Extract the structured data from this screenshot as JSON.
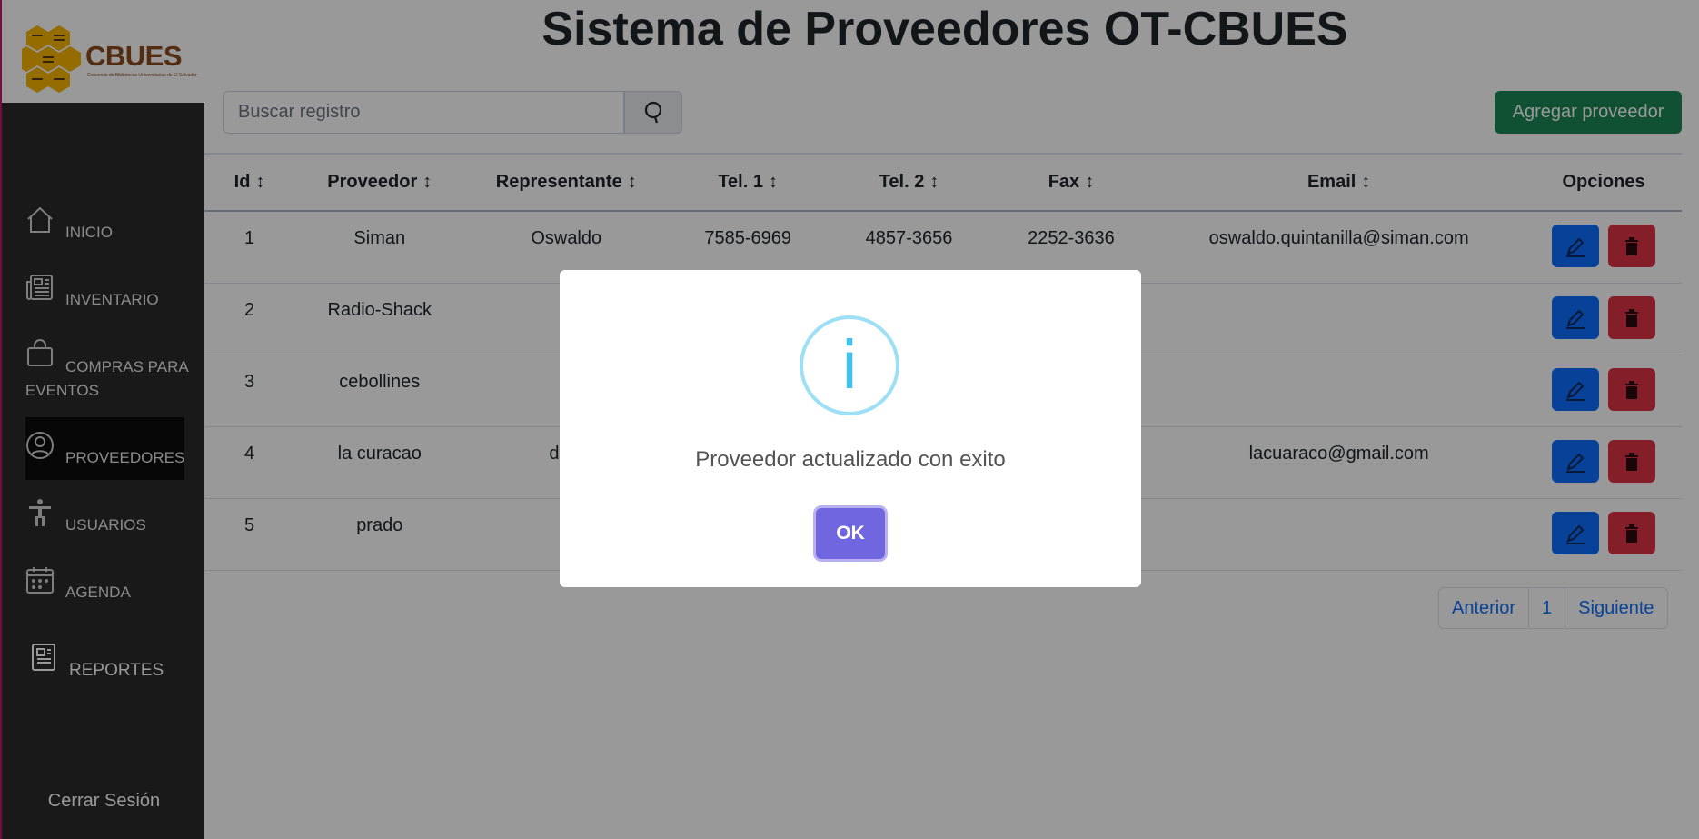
{
  "brand": {
    "name": "CBUES",
    "subtitle": "Consorcio de Bibliotecas Universitarias de El Salvador",
    "colors": {
      "brand_brown": "#8c4a1c",
      "honey": "#f7b500"
    }
  },
  "sidebar": {
    "items": [
      {
        "label": "INICIO",
        "icon": "home-icon"
      },
      {
        "label": "INVENTARIO",
        "icon": "newspaper-icon"
      },
      {
        "label_line1": "COMPRAS PARA",
        "label_line2": "EVENTOS",
        "icon": "shopping-bag-icon"
      },
      {
        "label": "PROVEEDORES",
        "icon": "person-circle-icon",
        "active": true
      },
      {
        "label": "USUARIOS",
        "icon": "universal-access-icon"
      },
      {
        "label": "AGENDA",
        "icon": "calendar-icon"
      },
      {
        "label": "REPORTES",
        "icon": "report-icon"
      }
    ],
    "logout_label": "Cerrar Sesión"
  },
  "main": {
    "title": "Sistema de Proveedores OT-CBUES",
    "search_placeholder": "Buscar registro",
    "add_button": "Agregar proveedor",
    "table": {
      "headers": [
        "Id",
        "Proveedor",
        "Representante",
        "Tel. 1",
        "Tel. 2",
        "Fax",
        "Email",
        "Opciones"
      ],
      "rows": [
        {
          "id": "1",
          "proveedor": "Siman",
          "representante": "Oswaldo",
          "tel1": "7585-6969",
          "tel2": "4857-3656",
          "fax": "2252-3636",
          "email": "oswaldo.quintanilla@siman.com"
        },
        {
          "id": "2",
          "proveedor": "Radio-Shack",
          "representante": "",
          "tel1": "",
          "tel2": "",
          "fax": "",
          "email": ""
        },
        {
          "id": "3",
          "proveedor": "cebollines",
          "representante": "",
          "tel1": "",
          "tel2": "",
          "fax": "",
          "email": ""
        },
        {
          "id": "4",
          "proveedor": "la curacao",
          "representante": "dani",
          "tel1": "",
          "tel2": "",
          "fax": "",
          "email": "lacuaraco@gmail.com"
        },
        {
          "id": "5",
          "proveedor": "prado",
          "representante": "",
          "tel1": "",
          "tel2": "",
          "fax": "",
          "email": ""
        }
      ]
    },
    "pagination": {
      "prev": "Anterior",
      "page": "1",
      "next": "Siguiente"
    }
  },
  "modal": {
    "icon": "info-icon",
    "icon_glyph": "i",
    "message": "Proveedor actualizado con exito",
    "ok_label": "OK"
  }
}
